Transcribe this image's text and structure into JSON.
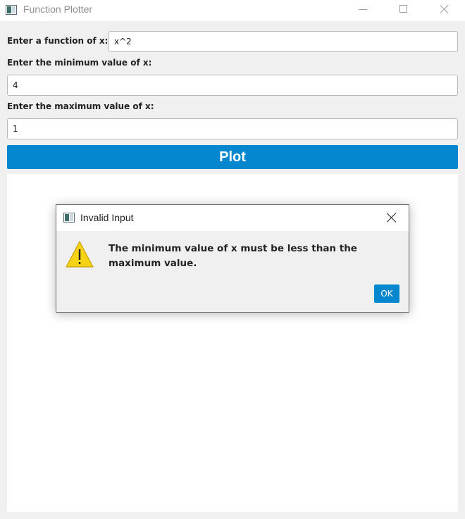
{
  "window": {
    "title": "Function Plotter",
    "icon": "app-window-icon",
    "controls": [
      "minimize-icon",
      "maximize-icon",
      "close-icon"
    ]
  },
  "form": {
    "function_label": "Enter a function of x:",
    "function_value": "x^2",
    "min_label": "Enter the minimum value of x:",
    "min_value": "4",
    "max_label": "Enter the maximum value of x:",
    "max_value": "1",
    "plot_button": "Plot"
  },
  "dialog": {
    "title": "Invalid Input",
    "icon": "warning-icon",
    "message": "The minimum value of x must be less than the maximum value.",
    "ok_button": "OK"
  },
  "colors": {
    "accent": "#0487cf",
    "window_bg": "#f0f0f0",
    "canvas_bg": "#ffffff",
    "warning": "#f6d215"
  }
}
